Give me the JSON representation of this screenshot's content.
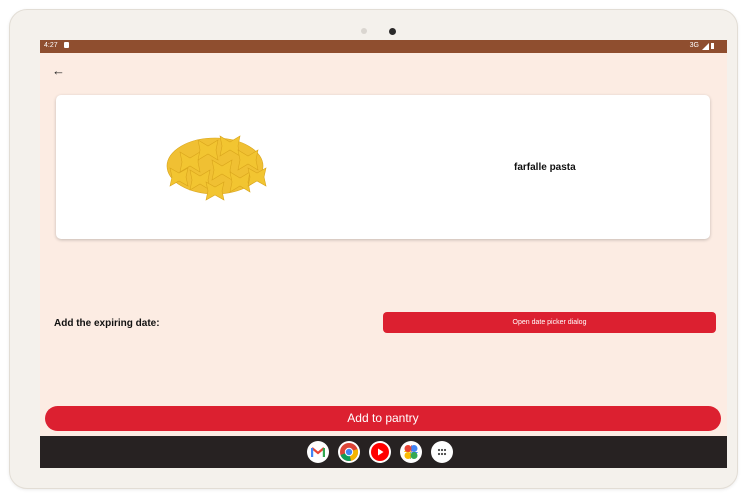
{
  "status_bar": {
    "time": "4:27",
    "network": "3G"
  },
  "product": {
    "name": "farfalle pasta"
  },
  "expiry": {
    "label": "Add the expiring date:",
    "button_label": "Open date picker dialog"
  },
  "actions": {
    "add_label": "Add to pantry"
  },
  "dock": {
    "apps": [
      "gmail-icon",
      "chrome-icon",
      "youtube-icon",
      "photos-icon",
      "app-drawer-icon"
    ]
  },
  "colors": {
    "status_bar": "#8f4e2f",
    "background": "#fcece3",
    "accent": "#dc2030",
    "nav_bar": "#272222"
  }
}
